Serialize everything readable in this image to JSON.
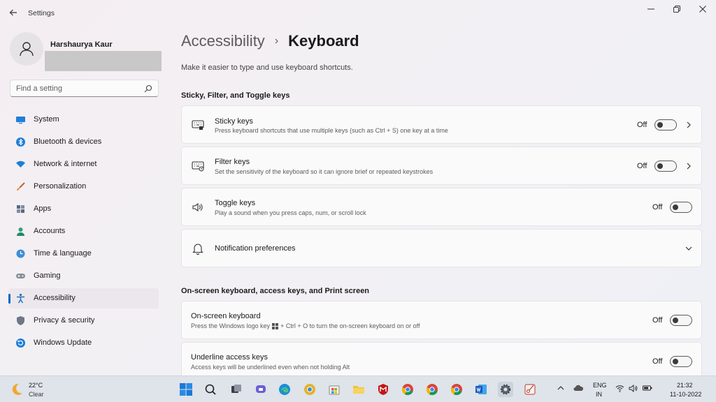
{
  "window": {
    "title": "Settings",
    "back_icon": "arrow-left-icon",
    "controls": [
      "minimize-icon",
      "restore-icon",
      "close-icon"
    ]
  },
  "profile": {
    "name": "Harshaurya Kaur",
    "avatar_icon": "person-icon"
  },
  "search": {
    "placeholder": "Find a setting",
    "value": ""
  },
  "sidebar": {
    "items": [
      {
        "label": "System",
        "icon": "monitor-icon"
      },
      {
        "label": "Bluetooth & devices",
        "icon": "bluetooth-icon"
      },
      {
        "label": "Network & internet",
        "icon": "wifi-icon"
      },
      {
        "label": "Personalization",
        "icon": "brush-icon"
      },
      {
        "label": "Apps",
        "icon": "apps-icon"
      },
      {
        "label": "Accounts",
        "icon": "account-icon"
      },
      {
        "label": "Time & language",
        "icon": "globe-clock-icon"
      },
      {
        "label": "Gaming",
        "icon": "gamepad-icon"
      },
      {
        "label": "Accessibility",
        "icon": "accessibility-icon",
        "active": true
      },
      {
        "label": "Privacy & security",
        "icon": "shield-icon"
      },
      {
        "label": "Windows Update",
        "icon": "update-icon"
      }
    ]
  },
  "header": {
    "parent": "Accessibility",
    "separator": "›",
    "current": "Keyboard",
    "subtitle": "Make it easier to type and use keyboard shortcuts."
  },
  "sections": {
    "sticky_filter_toggle": "Sticky, Filter, and Toggle keys",
    "onscreen": "On-screen keyboard, access keys, and Print screen"
  },
  "settings": {
    "sticky": {
      "title": "Sticky keys",
      "desc": "Press keyboard shortcuts that use multiple keys (such as Ctrl + S) one key at a time",
      "state": "Off"
    },
    "filter": {
      "title": "Filter keys",
      "desc": "Set the sensitivity of the keyboard so it can ignore brief or repeated keystrokes",
      "state": "Off"
    },
    "toggle": {
      "title": "Toggle keys",
      "desc": "Play a sound when you press caps, num, or scroll lock",
      "state": "Off"
    },
    "notifications": {
      "title": "Notification preferences"
    },
    "onscreen": {
      "title": "On-screen keyboard",
      "desc_pre": "Press the Windows logo key",
      "desc_post": "+ Ctrl + O to turn the on-screen keyboard on or off",
      "state": "Off"
    },
    "underline": {
      "title": "Underline access keys",
      "desc": "Access keys will be underlined even when not holding Alt",
      "state": "Off"
    }
  },
  "taskbar": {
    "weather": {
      "temp": "22°C",
      "condition": "Clear"
    },
    "language": {
      "line1": "ENG",
      "line2": "IN"
    },
    "clock": {
      "time": "21:32",
      "date": "11-10-2022"
    }
  },
  "colors": {
    "accent": "#0067c0",
    "background": "#f3f0f4",
    "card": "#fafafa",
    "taskbar": "#dfe3ea"
  }
}
